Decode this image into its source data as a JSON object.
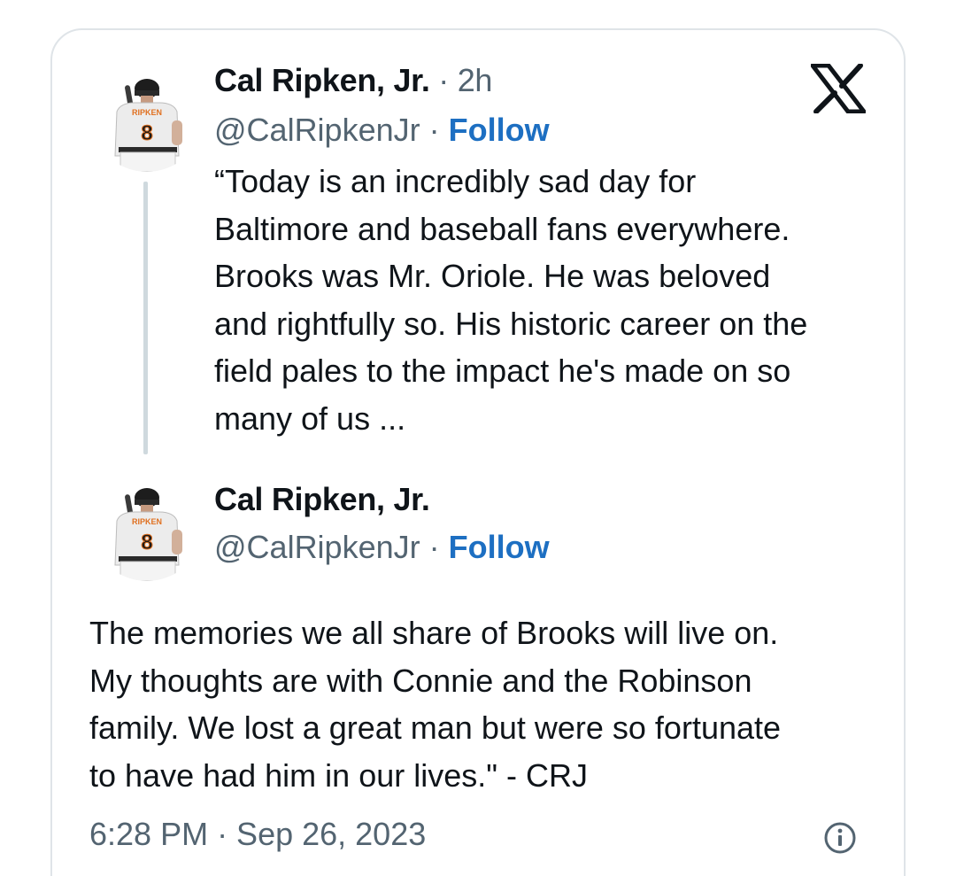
{
  "quoted_tweet": {
    "author_name": "Cal Ripken, Jr.",
    "separator": " · ",
    "time_ago": "2h",
    "handle": "@CalRipkenJr",
    "follow_label": "Follow",
    "text": "“Today is an incredibly sad day for\nBaltimore and baseball fans everywhere.\nBrooks was Mr. Oriole. He was beloved\nand rightfully so. His historic career on the\nfield pales to the impact he's made on so\nmany of us ..."
  },
  "main_tweet": {
    "author_name": "Cal Ripken, Jr.",
    "handle": "@CalRipkenJr",
    "separator": " · ",
    "follow_label": "Follow",
    "text": "The memories we all share of Brooks will live on.\nMy thoughts are with Connie and the Robinson\nfamily. We lost a great man but were so fortunate\nto have had him in our lives.\" - CRJ",
    "timestamp": "6:28 PM · Sep 26, 2023"
  },
  "avatar_jersey_text": "RIPKEN",
  "avatar_jersey_number": "8",
  "icons": {
    "brand": "x-logo-icon",
    "info": "info-icon"
  },
  "colors": {
    "text_primary": "#0f1419",
    "text_secondary": "#536471",
    "follow_blue": "#1d6fc2",
    "border": "#dfe4e8",
    "thread_line": "#cfd9de"
  }
}
